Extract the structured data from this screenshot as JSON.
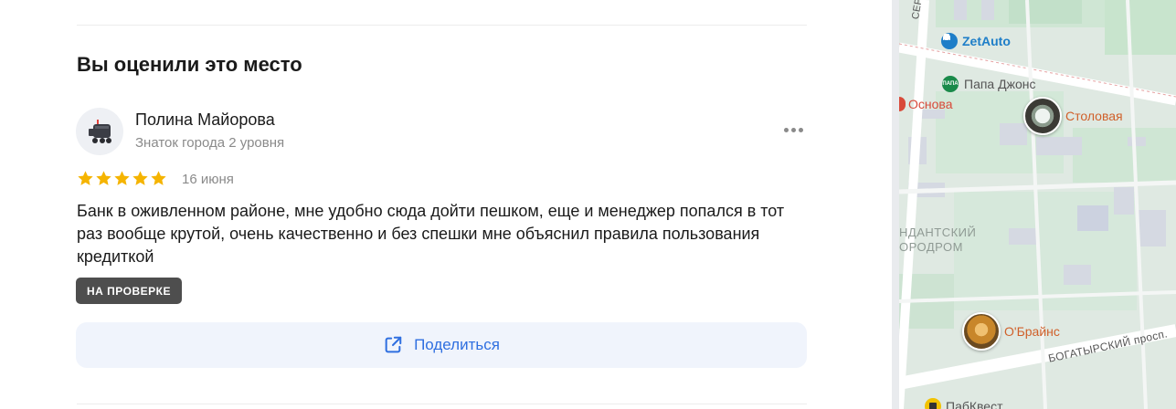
{
  "section": {
    "title": "Вы оценили это место"
  },
  "review": {
    "author_name": "Полина Майорова",
    "author_level": "Знаток города 2 уровня",
    "rating": 5,
    "date": "16 июня",
    "text": "Банк в оживленном районе, мне удобно сюда дойти пешком, еще и менеджер попался в тот раз вообще крутой, очень качественно и без спешки мне объяснил правила пользования кредиткой",
    "status_badge": "НА ПРОВЕРКЕ"
  },
  "share": {
    "label": "Поделиться"
  },
  "map": {
    "pois": [
      {
        "name": "ZetAuto",
        "icon": "car-icon",
        "color": "#1e7ec8"
      },
      {
        "name": "Папа Джонс",
        "icon": "papa-logo-icon",
        "color": "#1a8a4a"
      },
      {
        "name": "Основа",
        "icon": "map-pin-icon",
        "color": "#d84a3a"
      },
      {
        "name": "Столовая",
        "icon": "food-photo-icon",
        "color": "#d0602a"
      },
      {
        "name": "О'Брайнс",
        "icon": "food-photo-icon",
        "color": "#d0602a"
      },
      {
        "name": "ПабКвест",
        "icon": "metro-icon",
        "color": "#f2c200"
      }
    ],
    "district_line1": "НДАНТСКИЙ",
    "district_line2": "ОРОДРОМ",
    "road_top": "СЕРЕБРИС",
    "road_bottom": "БОГАТЫРСКИЙ просп."
  },
  "colors": {
    "accent": "#2f6fe0",
    "star": "#f5b400",
    "badge": "#4e4e4e"
  }
}
